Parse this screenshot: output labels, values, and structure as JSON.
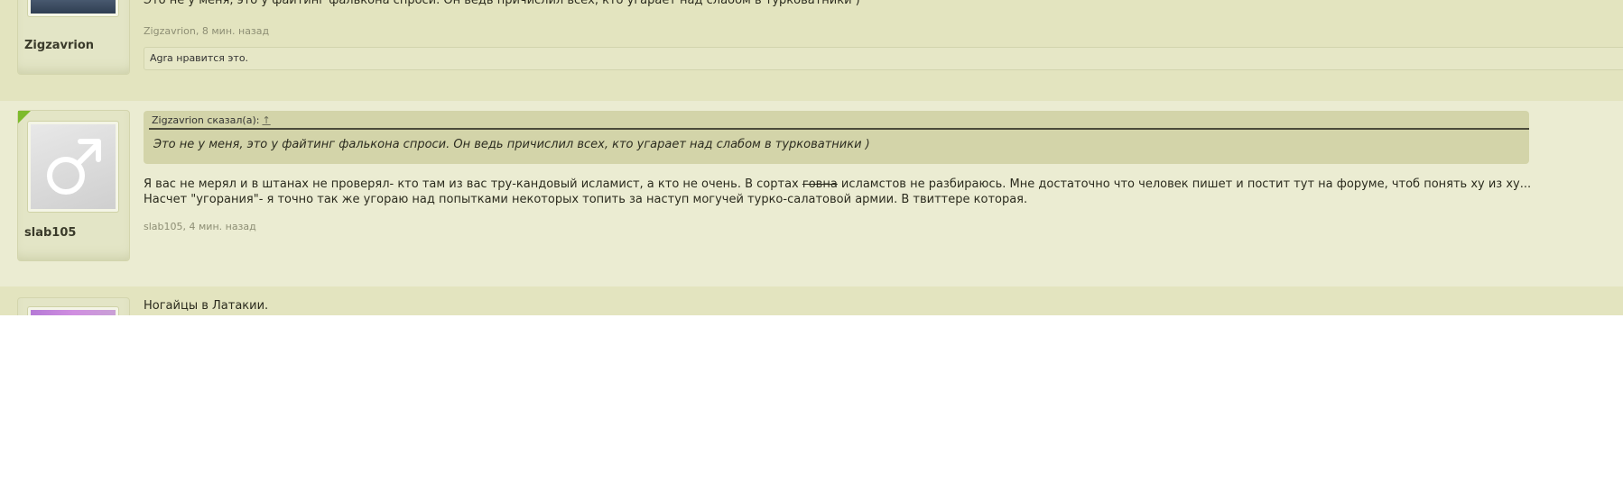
{
  "posts": [
    {
      "author": "Zigzavrion",
      "text_top": "Это не у меня, это у файтинг фалькона спроси. Он ведь причислил всех, кто угарает над слабом в турковатники )",
      "meta": "Zigzavrion, 8 мин. назад",
      "likes": "Agra нравится это."
    },
    {
      "author": "slab105",
      "quote_author": "Zigzavrion сказал(а):",
      "quote_arrow": "↑",
      "quote_text": "Это не у меня, это у файтинг фалькона спроси. Он ведь причислил всех, кто угарает над слабом в турковатники )",
      "line1_before": "Я вас не мерял и в штанах не проверял- кто там из вас тру-кандовый исламист, а кто не очень. В сортах ",
      "line1_strike": "говна",
      "line1_after": " исламстов не разбираюсь. Мне достаточно что человек пишет и постит тут на форуме, чтоб понять ху из ху...",
      "line2": "Насчет \"угорания\"- я точно так же угораю над попытками некоторых топить за наступ могучей турко-салатовой армии. В твиттере которая.",
      "meta": "slab105, 4 мин. назад"
    },
    {
      "text": "Ногайцы в Латакии."
    }
  ],
  "icons": {
    "default_avatar": "male-symbol-icon",
    "online": "online-indicator-icon"
  },
  "colors": {
    "online": "#7dbb2c",
    "quote_bg": "#d3d4a9",
    "post_bg": "#e3e4bf"
  }
}
